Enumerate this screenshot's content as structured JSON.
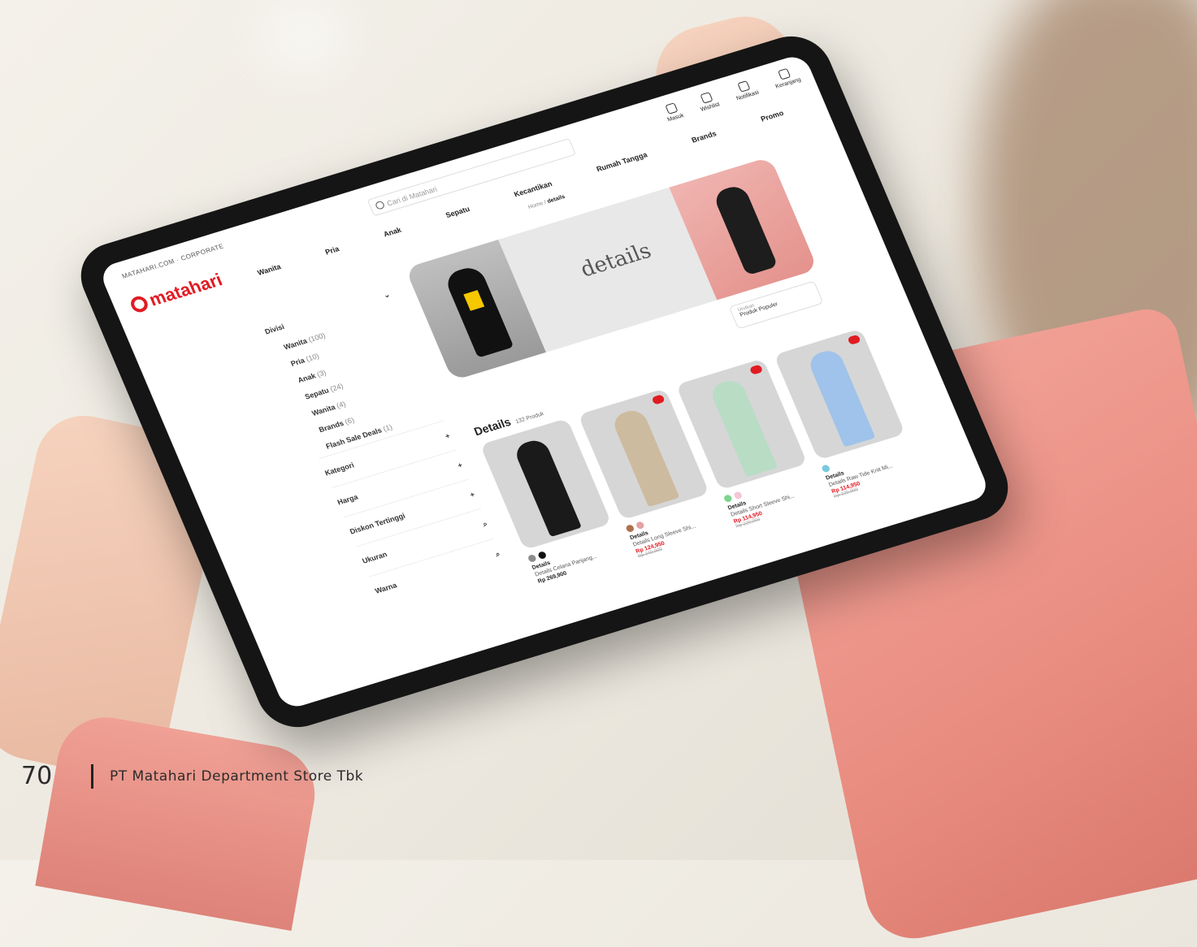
{
  "site": {
    "top_strip": "MATAHARI.COM · CORPORATE",
    "logo_text": "matahari",
    "search_placeholder": "Cari di Matahari",
    "nav": [
      "Wanita",
      "Pria",
      "Anak",
      "Sepatu",
      "Kecantikan",
      "Rumah Tangga",
      "Brands",
      "Promo"
    ],
    "actions": [
      "Masuk",
      "Wishlist",
      "Notifikasi",
      "Keranjang"
    ],
    "breadcrumb": {
      "parent": "Home",
      "current": "details"
    }
  },
  "banner": {
    "title": "details"
  },
  "sidebar": {
    "heading": "Divisi",
    "categories": [
      {
        "label": "Wanita",
        "count": "(100)"
      },
      {
        "label": "Pria",
        "count": "(10)"
      },
      {
        "label": "Anak",
        "count": "(3)"
      },
      {
        "label": "Sepatu",
        "count": "(24)"
      },
      {
        "label": "Wanita",
        "count": "(4)"
      },
      {
        "label": "Brands",
        "count": "(6)"
      },
      {
        "label": "Flash Sale Deals",
        "count": "(1)"
      }
    ],
    "filters": [
      "Kategori",
      "Harga",
      "Diskon Tertinggi",
      "Ukuran",
      "Warna"
    ]
  },
  "sort": {
    "label": "Urutkan",
    "value": "Produk Populer"
  },
  "section": {
    "title": "Details",
    "subtitle": "132 Produk"
  },
  "products": [
    {
      "brand": "Details",
      "name": "Details Celana Panjang...",
      "price": "Rp 269,900",
      "old_price": "",
      "swatches": [
        "#8c8c8c",
        "#111111"
      ],
      "figure_color": "#1a1a1a",
      "sale": false
    },
    {
      "brand": "Details",
      "name": "Details Long Sleeve Shi...",
      "price": "Rp 124,950",
      "old_price": "Rp 249,900",
      "swatches": [
        "#b0704f",
        "#e2a2a4"
      ],
      "figure_color": "#cdbba0",
      "sale": true
    },
    {
      "brand": "Details",
      "name": "Details Short Sleeve Shi...",
      "price": "Rp 114,950",
      "old_price": "Rp 229,900",
      "swatches": [
        "#7ed38f",
        "#f5c6d2"
      ],
      "figure_color": "#b9dcc4",
      "sale": true
    },
    {
      "brand": "Details",
      "name": "Details Raw Tide Knit Mi...",
      "price": "Rp 114,950",
      "old_price": "Rp 229,900",
      "swatches": [
        "#79c9e0"
      ],
      "figure_color": "#9fc3ea",
      "sale": true
    }
  ],
  "page": {
    "number": "70",
    "company": "PT Matahari Department Store Tbk"
  }
}
